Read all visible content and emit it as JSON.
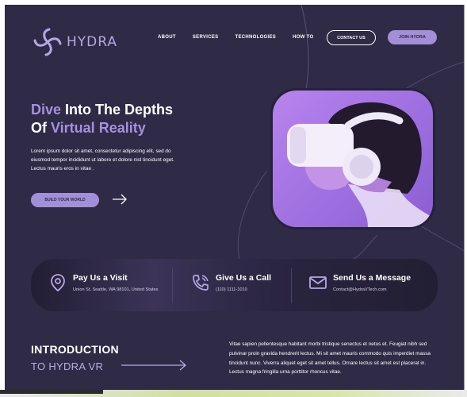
{
  "brand": {
    "name": "HYDRA"
  },
  "nav": {
    "items": [
      "ABOUT",
      "SERVICES",
      "TECHNOLOGIES",
      "HOW TO"
    ]
  },
  "header": {
    "contact_label": "CONTACT US",
    "join_label": "JOIN HYDRA"
  },
  "hero": {
    "title_hl1": "Dive",
    "title_rest1": " Into The Depths",
    "title_of": "Of ",
    "title_hl2": "Virtual Reality",
    "description": "Lorem ipsum dolor sit amet, consectetur adipiscing elit, sed do eiusmod tempor incididunt ut labore et dolore nisl tincidunt eget. Lectus mauris eros in vitae .",
    "cta_label": "BUILD YOUR WORLD"
  },
  "contact": {
    "visit": {
      "title": "Pay Us a Visit",
      "detail": "Union St, Seattle, WA 98101, United States"
    },
    "call": {
      "title": "Give Us a Call",
      "detail": "(110) 1111-1010"
    },
    "message": {
      "title": "Send Us a Message",
      "detail": "Contact@HydraVTech.com"
    }
  },
  "intro": {
    "title": "INTRODUCTION",
    "subtitle": "TO HYDRA VR",
    "body": "Vitae sapien pellentesque habitant morbi tristique senectus et netus et. Feugiat nibh sed pulvinar proin gravida hendrerit lectus. Mi sit amet mauris commodo quis imperdiet massa tincidunt nunc. Viverra aliquet eget sit amet tellus. Ornare lectus sit amet est placerat in. Lectus magna fringilla urna porttitor rhoncus vitae."
  },
  "colors": {
    "background": "#2f2a45",
    "accent": "#a591df",
    "button": "#a38fd8",
    "text": "#ffffff"
  },
  "icons": [
    "hydra-logo-icon",
    "arrow-right-icon",
    "vr-headset-image",
    "location-pin-icon",
    "phone-icon",
    "envelope-icon"
  ]
}
